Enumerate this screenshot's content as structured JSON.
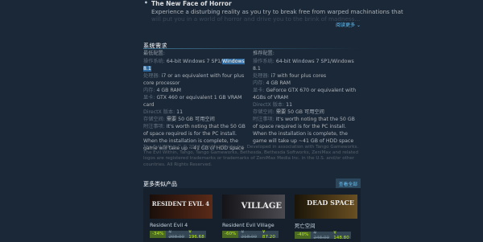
{
  "description": {
    "title": "The New Face of Horror",
    "line1": "Experience a disturbing reality as you try to break free from warped machinations that",
    "line2": "will put you in a world of horror and drive you to the brink of madness...",
    "read_more": "阅读更多 ⌄"
  },
  "sysreq": {
    "header": "系统需求",
    "min": {
      "title": "最低配置:",
      "os_key": "操作系统:",
      "os_val_a": "64-bit Windows 7 SP1/",
      "os_val_b": "Windows 8.1",
      "cpu_key": "处理器:",
      "cpu_val": "i7 or an equivalent with four plus core processor",
      "mem_key": "内存:",
      "mem_val": "4 GB RAM",
      "gpu_key": "显卡:",
      "gpu_val": "GTX 460 or equivalent 1 GB VRAM card",
      "dx_key": "DirectX 版本:",
      "dx_val": "11",
      "storage_key": "存储空间:",
      "storage_val": "需要 50 GB 可用空间",
      "notes_key": "附注事项:",
      "notes_val": "It's worth noting that the 50 GB of space required is for the PC install. When the installation is complete, the game will take up ~41 GB of HDD space"
    },
    "rec": {
      "title": "推荐配置:",
      "os_key": "操作系统:",
      "os_val": "64-bit Windows 7 SP1/Windows 8.1",
      "cpu_key": "处理器:",
      "cpu_val": "i7 with four plus cores",
      "mem_key": "内存:",
      "mem_val": "4 GB RAM",
      "gpu_key": "显卡:",
      "gpu_val": "GeForce GTX 670 or equivalent with 4GBs of VRAM",
      "dx_key": "DirectX 版本:",
      "dx_val": "11",
      "storage_key": "存储空间:",
      "storage_val": "需要 50 GB 可用空间",
      "notes_key": "附注事项:",
      "notes_val": "It's worth noting that the 50 GB of space required is for the PC install. When the installation is complete, the game will take up ~41 GB of HDD space"
    }
  },
  "legal": "The Evil Within™ © 2014 ZeniMax Media Inc. Developed in association with Tango Gameworks. The Evil Within, Tango, Tango Gameworks, Bethesda, Bethesda Softworks, ZeniMax and related logos are registered trademarks or trademarks of ZeniMax Media Inc. in the U.S. and/or other countries. All Rights Reserved.",
  "more_like": {
    "header": "更多类似产品",
    "view_all": "查看全部",
    "items": [
      {
        "name": "Resident Evil 4",
        "thumb": "RESIDENT EVIL 4",
        "discount": "-34%",
        "original": "¥ 298.00",
        "final": "¥ 196.68",
        "color": "#3a1f14"
      },
      {
        "name": "Resident Evil Village",
        "thumb": "VILLAGE",
        "discount": "-60%",
        "original": "¥ 218.00",
        "final": "¥ 87.20",
        "color": "#2b2b2e"
      },
      {
        "name": "死亡空间",
        "thumb": "DEAD SPACE",
        "discount": "-40%",
        "original": "¥ 248.00",
        "final": "¥ 148.80",
        "color": "#3b2e18"
      }
    ]
  }
}
